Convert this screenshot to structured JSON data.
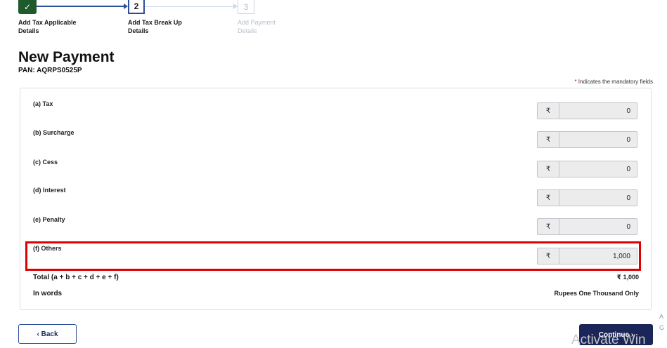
{
  "stepper": {
    "steps": [
      {
        "number": "✓",
        "label_line1": "Add Tax Applicable",
        "label_line2": "Details",
        "state": "done"
      },
      {
        "number": "2",
        "label_line1": "Add Tax Break Up",
        "label_line2": "Details",
        "state": "active"
      },
      {
        "number": "3",
        "label_line1": "Add Payment",
        "label_line2": "Details",
        "state": "pending"
      }
    ],
    "icons": {
      "completed": "checkmark-icon"
    }
  },
  "page": {
    "title": "New Payment",
    "pan": "PAN: AQRPS0525P",
    "mandatory_star": "*",
    "mandatory_note": " Indicates the mandatory fields"
  },
  "rows": [
    {
      "label": "(a) Tax",
      "currency": "₹",
      "value": "0"
    },
    {
      "label": "(b) Surcharge",
      "currency": "₹",
      "value": "0"
    },
    {
      "label": "(c) Cess",
      "currency": "₹",
      "value": "0"
    },
    {
      "label": "(d) Interest",
      "currency": "₹",
      "value": "0"
    },
    {
      "label": "(e) Penalty",
      "currency": "₹",
      "value": "0"
    },
    {
      "label": "(f) Others",
      "currency": "₹",
      "value": "1,000"
    }
  ],
  "summary": {
    "total_label": "Total (a + b + c + d + e + f)",
    "total_value": "₹ 1,000",
    "words_label": "In words",
    "words_value": "Rupees One Thousand Only"
  },
  "buttons": {
    "back": "‹ Back",
    "continue": "Continue ›"
  },
  "watermark": {
    "text": "Activate Win",
    "frag1": "A",
    "frag2": "G"
  },
  "colors": {
    "primary": "#1b2658",
    "accent": "#2d4e9a",
    "done": "#1f5a2c",
    "highlight": "#e00000"
  }
}
